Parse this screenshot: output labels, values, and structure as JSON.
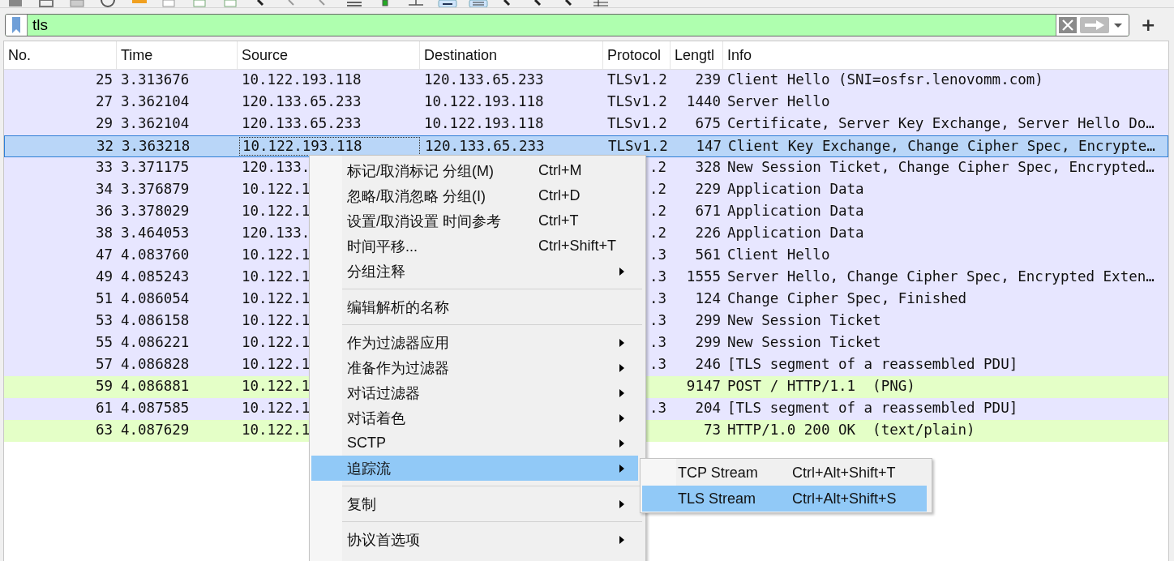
{
  "filter": {
    "value": "tls",
    "valid": true,
    "add_button": "+"
  },
  "table": {
    "columns": [
      "No.",
      "Time",
      "Source",
      "Destination",
      "Protocol",
      "Lengtl",
      "Info"
    ],
    "rows": [
      {
        "no": "25",
        "time": "3.313676",
        "source": "10.122.193.118",
        "destination": "120.133.65.233",
        "protocol": "TLSv1.2",
        "length": "239",
        "info": "Client Hello (SNI=osfsr.lenovomm.com)",
        "color": "#e7e6ff",
        "selected": false
      },
      {
        "no": "27",
        "time": "3.362104",
        "source": "120.133.65.233",
        "destination": "10.122.193.118",
        "protocol": "TLSv1.2",
        "length": "1440",
        "info": "Server Hello",
        "color": "#e7e6ff",
        "selected": false
      },
      {
        "no": "29",
        "time": "3.362104",
        "source": "120.133.65.233",
        "destination": "10.122.193.118",
        "protocol": "TLSv1.2",
        "length": "675",
        "info": "Certificate, Server Key Exchange, Server Hello Do…",
        "color": "#e7e6ff",
        "selected": false
      },
      {
        "no": "32",
        "time": "3.363218",
        "source": "10.122.193.118",
        "destination": "120.133.65.233",
        "protocol": "TLSv1.2",
        "length": "147",
        "info": "Client Key Exchange, Change Cipher Spec, Encrypte…",
        "selected": true
      },
      {
        "no": "33",
        "time": "3.371175",
        "source": "120.133.",
        "protocol": ".2",
        "length": "328",
        "info": "New Session Ticket, Change Cipher Spec, Encrypted…",
        "color": "#e7e6ff",
        "selected": false
      },
      {
        "no": "34",
        "time": "3.376879",
        "source": "10.122.1",
        "protocol": ".2",
        "length": "229",
        "info": "Application Data",
        "color": "#e7e6ff",
        "selected": false
      },
      {
        "no": "36",
        "time": "3.378029",
        "source": "10.122.1",
        "protocol": ".2",
        "length": "671",
        "info": "Application Data",
        "color": "#e7e6ff",
        "selected": false
      },
      {
        "no": "38",
        "time": "3.464053",
        "source": "120.133.",
        "protocol": ".2",
        "length": "226",
        "info": "Application Data",
        "color": "#e7e6ff",
        "selected": false
      },
      {
        "no": "47",
        "time": "4.083760",
        "source": "10.122.1",
        "protocol": ".3",
        "length": "561",
        "info": "Client Hello",
        "color": "#e7e6ff",
        "selected": false
      },
      {
        "no": "49",
        "time": "4.085243",
        "source": "10.122.1",
        "protocol": ".3",
        "length": "1555",
        "info": "Server Hello, Change Cipher Spec, Encrypted Exten…",
        "color": "#e7e6ff",
        "selected": false
      },
      {
        "no": "51",
        "time": "4.086054",
        "source": "10.122.1",
        "protocol": ".3",
        "length": "124",
        "info": "Change Cipher Spec, Finished",
        "color": "#e7e6ff",
        "selected": false
      },
      {
        "no": "53",
        "time": "4.086158",
        "source": "10.122.1",
        "protocol": ".3",
        "length": "299",
        "info": "New Session Ticket",
        "color": "#e7e6ff",
        "selected": false
      },
      {
        "no": "55",
        "time": "4.086221",
        "source": "10.122.1",
        "protocol": ".3",
        "length": "299",
        "info": "New Session Ticket",
        "color": "#e7e6ff",
        "selected": false
      },
      {
        "no": "57",
        "time": "4.086828",
        "source": "10.122.1",
        "protocol": ".3",
        "length": "246",
        "info": "[TLS segment of a reassembled PDU]",
        "color": "#e7e6ff",
        "selected": false
      },
      {
        "no": "59",
        "time": "4.086881",
        "source": "10.122.1",
        "length": "9147",
        "info": "POST / HTTP/1.1  (PNG)",
        "color": "#e4ffc7",
        "selected": false
      },
      {
        "no": "61",
        "time": "4.087585",
        "source": "10.122.1",
        "protocol": ".3",
        "length": "204",
        "info": "[TLS segment of a reassembled PDU]",
        "color": "#e7e6ff",
        "selected": false
      },
      {
        "no": "63",
        "time": "4.087629",
        "source": "10.122.1",
        "length": "73",
        "info": "HTTP/1.0 200 OK  (text/plain)",
        "color": "#e4ffc7",
        "selected": false
      }
    ]
  },
  "context_menu": {
    "items": [
      {
        "kind": "item",
        "label": "标记/取消标记 分组(M)",
        "shortcut": "Ctrl+M",
        "submenu": false,
        "selected": false
      },
      {
        "kind": "item",
        "label": "忽略/取消忽略 分组(I)",
        "shortcut": "Ctrl+D",
        "submenu": false,
        "selected": false
      },
      {
        "kind": "item",
        "label": "设置/取消设置 时间参考",
        "shortcut": "Ctrl+T",
        "submenu": false,
        "selected": false
      },
      {
        "kind": "item",
        "label": "时间平移...",
        "shortcut": "Ctrl+Shift+T",
        "submenu": false,
        "selected": false
      },
      {
        "kind": "item",
        "label": "分组注释",
        "submenu": true,
        "selected": false
      },
      {
        "kind": "separator"
      },
      {
        "kind": "item",
        "label": "编辑解析的名称",
        "submenu": false,
        "selected": false
      },
      {
        "kind": "separator"
      },
      {
        "kind": "item",
        "label": "作为过滤器应用",
        "submenu": true,
        "selected": false
      },
      {
        "kind": "item",
        "label": "准备作为过滤器",
        "submenu": true,
        "selected": false
      },
      {
        "kind": "item",
        "label": "对话过滤器",
        "submenu": true,
        "selected": false
      },
      {
        "kind": "item",
        "label": "对话着色",
        "submenu": true,
        "selected": false
      },
      {
        "kind": "item",
        "label": "SCTP",
        "submenu": true,
        "selected": false
      },
      {
        "kind": "item",
        "label": "追踪流",
        "submenu": true,
        "selected": true
      },
      {
        "kind": "separator"
      },
      {
        "kind": "item",
        "label": "复制",
        "submenu": true,
        "selected": false
      },
      {
        "kind": "separator"
      },
      {
        "kind": "item",
        "label": "协议首选项",
        "submenu": true,
        "selected": false
      }
    ]
  },
  "submenu": {
    "items": [
      {
        "label": "TCP Stream",
        "shortcut": "Ctrl+Alt+Shift+T",
        "selected": false
      },
      {
        "label": "TLS Stream",
        "shortcut": "Ctrl+Alt+Shift+S",
        "selected": true
      }
    ]
  }
}
